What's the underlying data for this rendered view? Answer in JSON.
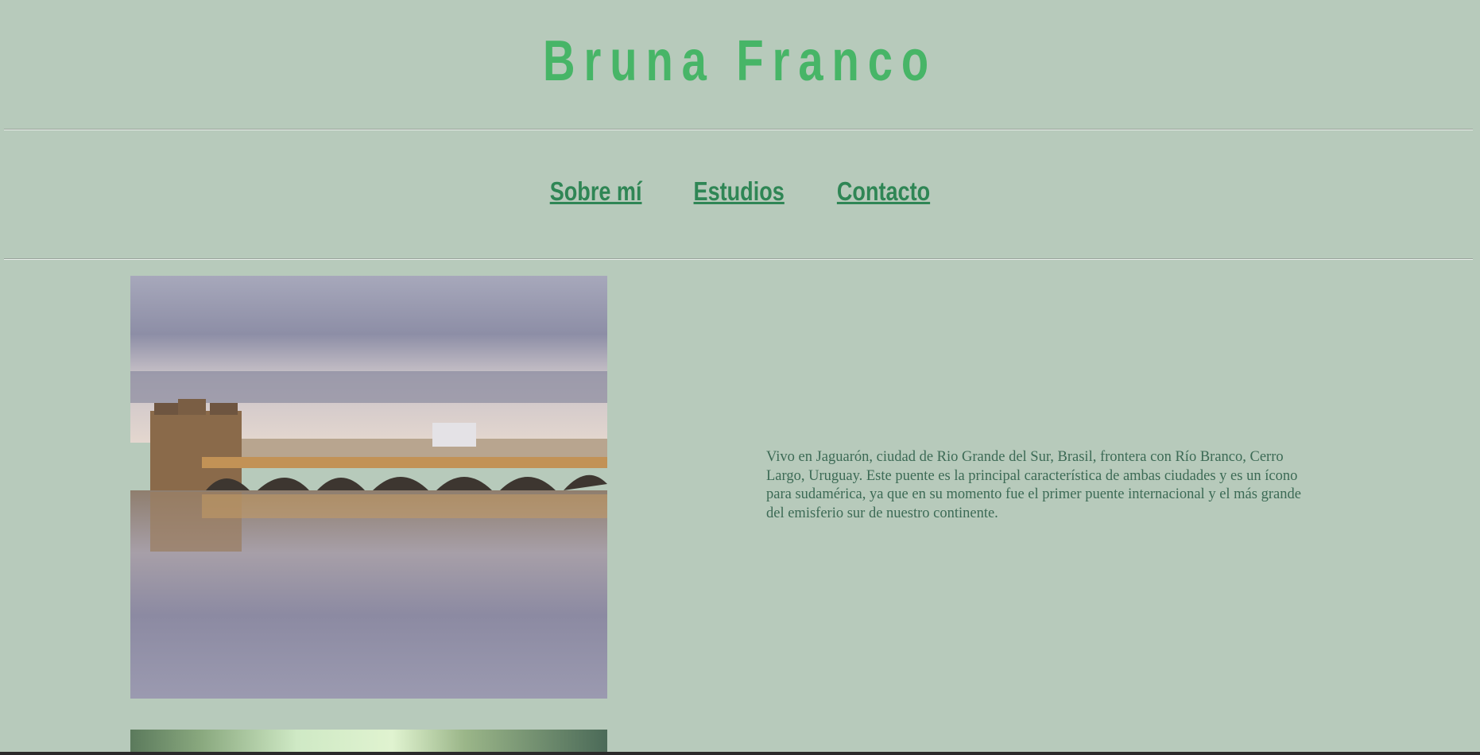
{
  "header": {
    "title": "Bruna Franco"
  },
  "nav": {
    "items": [
      {
        "label": "Sobre mí"
      },
      {
        "label": "Estudios"
      },
      {
        "label": "Contacto"
      }
    ]
  },
  "main": {
    "paragraph": "Vivo en Jaguarón, ciudad de Rio Grande del Sur, Brasil, frontera con Río Branco, Cerro Largo, Uruguay. Este puente es la principal característica de ambas ciudades y es un ícono para sudamérica, ya que en su momento fue el primer puente internacional y el más grande del emisferio sur de nuestro continente."
  },
  "colors": {
    "background": "#b7cabb",
    "title": "#47b567",
    "nav": "#2f8655",
    "text": "#3c6a55"
  }
}
